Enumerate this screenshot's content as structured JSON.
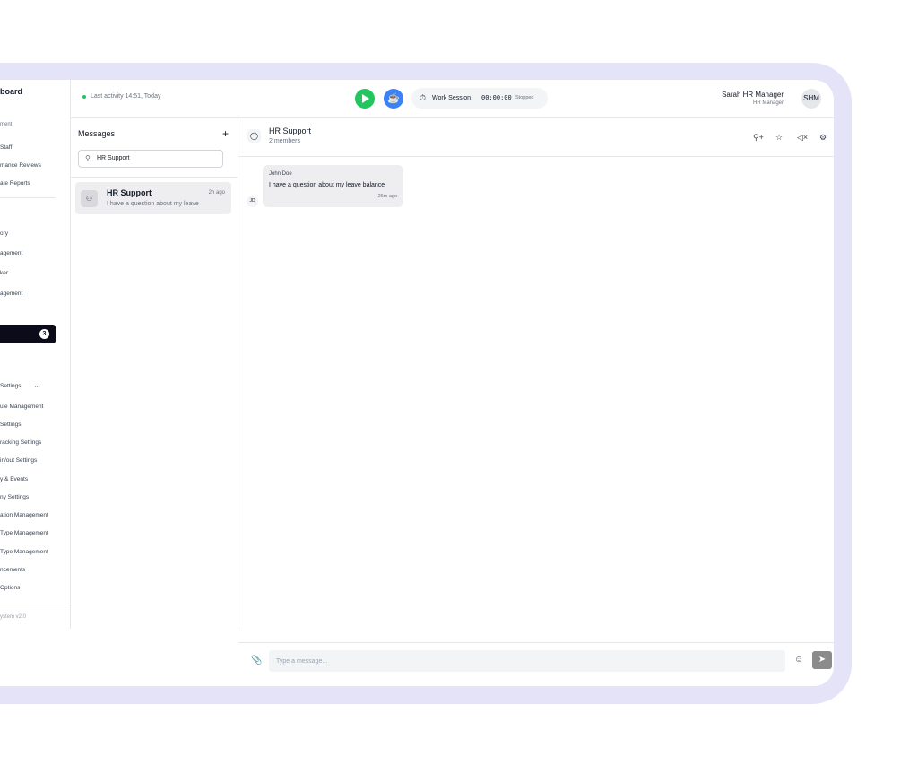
{
  "nav": {
    "brand": "board",
    "cut_top": "ment",
    "items": [
      "Staff",
      "mance Reviews",
      "ate Reports",
      "ory",
      "agement",
      "ker",
      "agement",
      "Settings",
      "ule Management",
      "Settings",
      "racking Settings",
      "in/out Settings",
      "y & Events",
      "ny Settings",
      "ation Management",
      "Type Management",
      "Type Management",
      "ncements",
      "Options"
    ],
    "messages_badge": "3",
    "footer": "ystem v2.0"
  },
  "topbar": {
    "last_activity": "Last activity 14:51, Today",
    "session_label": "Work Session",
    "session_time": "00:00:00",
    "session_status": "Stopped",
    "user_name": "Sarah HR Manager",
    "user_role": "HR Manager",
    "user_initials": "SHM"
  },
  "conversations": {
    "title": "Messages",
    "add": "+",
    "search_value": "HR Support",
    "items": [
      {
        "name": "HR Support",
        "time": "2h ago",
        "preview": "I have a question about my leave"
      }
    ]
  },
  "chat": {
    "group_name": "HR Support",
    "members": "2 members",
    "messages": [
      {
        "sender": "John Doe",
        "initials": "JD",
        "text": "I have a question about my leave balance",
        "time": "26m ago"
      }
    ],
    "input_placeholder": "Type a message..."
  },
  "colors": {
    "frame": "#e4e3f8",
    "play": "#22c55e",
    "break": "#3b82f6",
    "active_nav": "#0b0b1a"
  },
  "icons": {
    "play": "play-icon",
    "break": "coffee-icon",
    "stopwatch": "stopwatch-icon",
    "search": "search-icon",
    "group": "users-icon",
    "chat": "chat-bubble-icon",
    "add_member": "user-plus-icon",
    "star": "star-icon",
    "mute": "mute-icon",
    "settings": "gear-icon",
    "attach": "paperclip-icon",
    "emoji": "smiley-icon",
    "send": "send-icon"
  }
}
